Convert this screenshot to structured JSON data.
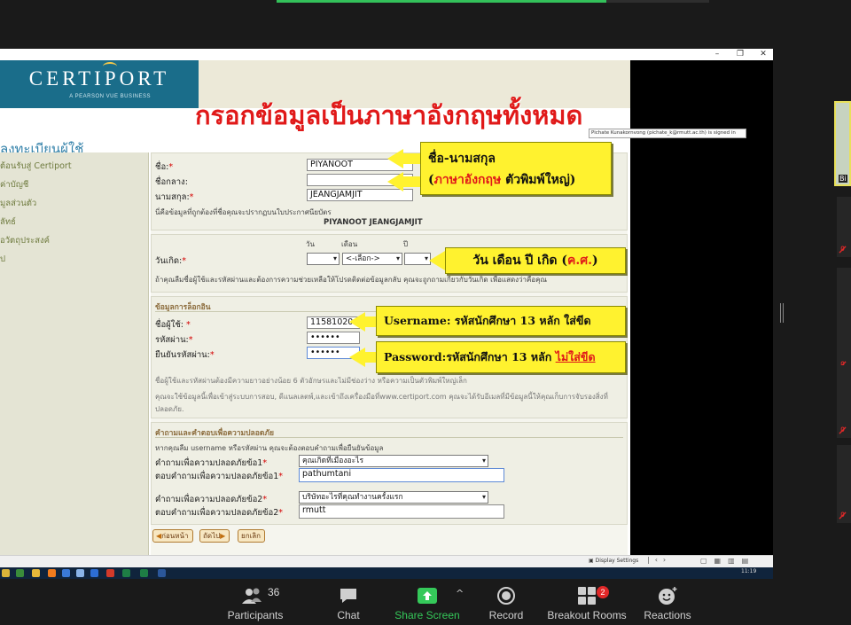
{
  "window": {
    "controls": [
      "–",
      "❐",
      "✕"
    ]
  },
  "tooltip": "Pichate Kunakornvong (pichate_k@rmutt.ac.th) is signed in",
  "header": {
    "logo_text": "CERTIPORT",
    "logo_sub": "A PEARSON VUE BUSINESS",
    "banner": "กรอกข้อมูลเป็นภาษาอังกฤษทั้งหมด"
  },
  "page_title": "ลงทะเบียนผู้ใช้",
  "sidebar": {
    "items": [
      "ต้อนรับสู่ Certiport",
      "ค่าบัญชี",
      "มูลส่วนตัว",
      "ลัทธ์",
      "อวัตถุประสงค์",
      "ป"
    ]
  },
  "name_section": {
    "first_label": "ชื่อ:",
    "middle_label": "ชื่อกลาง:",
    "last_label": "นามสกุล:",
    "first_value": "PIYANOOT",
    "middle_value": "",
    "last_value": "JEANGJAMJIT",
    "cert_note": "นี่คือข้อมูลที่ถูกต้องที่ชื่อคุณจะปรากฏบนใบประกาศนียบัตร",
    "cert_name": "PIYANOOT JEANGJAMJIT"
  },
  "birth_section": {
    "day_header": "วัน",
    "month_header": "เดือน",
    "year_header": "ปี",
    "label": "วันเกิด:",
    "day_value": "",
    "month_value": "<-เลือก->",
    "year_value": "",
    "note": "ถ้าคุณลืมชื่อผู้ใช้และรหัสผ่านและต้องการความช่วยเหลือให้โปรดติดต่อข้อมูลกลับ คุณจะถูกถามเกี่ยวกับวันเกิด เพื่อแสดงว่าคือคุณ"
  },
  "login_section": {
    "header": "ข้อมูลการล็อกอิน",
    "username_label": "ชื่อผู้ใช้:",
    "password_label": "รหัสผ่าน:",
    "confirm_label": "ยืนยันรหัสผ่าน:",
    "username_value": "11581020",
    "password_value": "••••••",
    "confirm_value": "••••••",
    "note1": "ชื่อผู้ใช้และรหัสผ่านต้องมีความยาวอย่างน้อย 6 ตัวอักษรและไม่มีช่องว่าง หรือความเป็นตัวพิมพ์ใหญ่เล็ก",
    "note2": "คุณจะใช้ข้อมูลนี้เพื่อเข้าสู่ระบบการสอบ, ดีแนลเลตพ์,และเข้าถึงเครื่องมือที่www.certiport.com คุณจะได้รับอีเมลที่มีข้อมูลนี้ให้คุณเก็บการจับรองสิ่งที่",
    "note3": "ปลอดภัย."
  },
  "security_section": {
    "header": "คำถามและคำตอบเพื่อความปลอดภัย",
    "note": "หากคุณลืม username หรือรหัสผ่าน คุณจะต้องตอบคำถามเพื่อยืนยันข้อมูล",
    "q1_label": "คำถามเพื่อความปลอดภัยข้อ1",
    "a1_label": "ตอบคำถามเพื่อความปลอดภัยข้อ1",
    "q1_value": "คุณเกิดที่เมืองอะไร",
    "a1_value": "pathumtani",
    "q2_label": "คำถามเพื่อความปลอดภัยข้อ2",
    "a2_label": "ตอบคำถามเพื่อความปลอดภัยข้อ2",
    "q2_value": "บริษัทอะไรที่คุณทำงานครั้งแรก",
    "a2_value": "rmutt"
  },
  "buttons": {
    "back": "ก่อนหน้า",
    "next": "ถัดไป",
    "cancel": "ยกเลิก"
  },
  "callouts": {
    "name_line1": "ชื่อ-นามสกุล",
    "name_red": "ภาษาอังกฤษ",
    "name_rest": "ตัวพิมพ์ใหญ่)",
    "name_open": "(",
    "birth_main": "วัน เดือน ปี เกิด (",
    "birth_red": "ค.ศ.",
    "birth_close": ")",
    "username": "Username: รหัสนักศึกษา 13 หลัก ใส่ขีด",
    "password_main": "Password:รหัสนักศึกษา 13 หลัก ",
    "password_red": "ไม่ใส่ขีด"
  },
  "status_bar": {
    "display_settings": "Display Settings",
    "time": "11:19"
  },
  "participant_thumb": {
    "label": "Bi"
  },
  "zoom_toolbar": {
    "participants_count": "36",
    "participants_label": "Participants",
    "chat_label": "Chat",
    "share_label": "Share Screen",
    "record_label": "Record",
    "breakout_label": "Breakout Rooms",
    "breakout_badge": "2",
    "reactions_label": "Reactions"
  },
  "colors": {
    "callout": "#fff22f",
    "banner_red": "#e01919",
    "share_green": "#35c95a",
    "logo_band": "#1a6d8a"
  }
}
